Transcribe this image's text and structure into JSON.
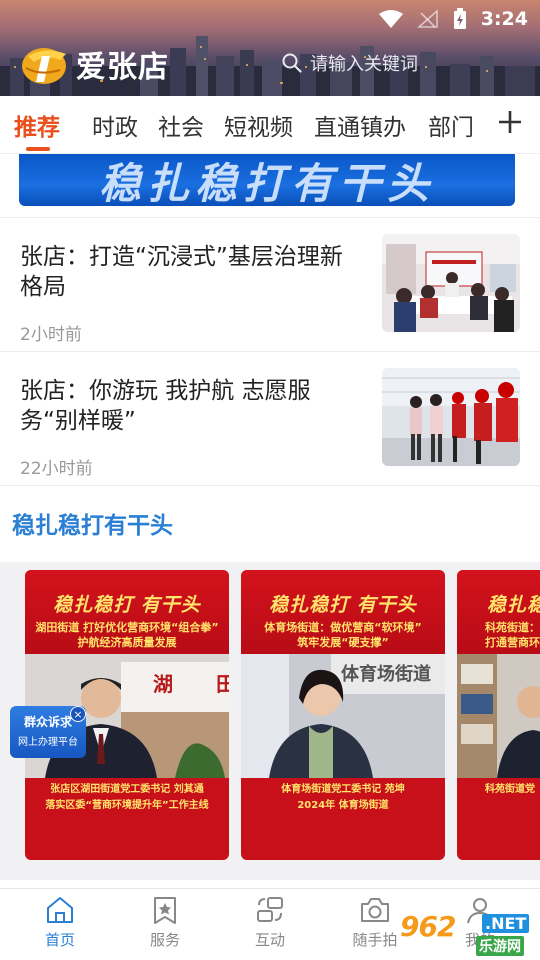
{
  "status_bar": {
    "time": "3:24"
  },
  "header": {
    "app_name": "爱张店",
    "search_placeholder": "请输入关键词"
  },
  "tabs": [
    {
      "label": "推荐",
      "active": true
    },
    {
      "label": "时政"
    },
    {
      "label": "社会"
    },
    {
      "label": "短视频"
    },
    {
      "label": "直通镇办"
    },
    {
      "label": "部门"
    }
  ],
  "banner": {
    "text": "稳扎稳打有干头"
  },
  "news": [
    {
      "title": "张店：打造“沉浸式”基层治理新格局",
      "time": "2小时前"
    },
    {
      "title": "张店：你游玩  我护航  志愿服务“别样暖”",
      "time": "22小时前"
    }
  ],
  "section": {
    "title": "稳扎稳打有干头"
  },
  "cards": [
    {
      "brand": "稳扎稳打 有干头",
      "sub1": "湖田街道 打好优化营商环境“组合拳”",
      "sub2": "护航经济高质量发展",
      "sign": "湖 田",
      "caption1": "张店区湖田街道党工委书记 刘其通",
      "caption2": "落实区委“营商环境提升年”工作主线"
    },
    {
      "brand": "稳扎稳打 有干头",
      "sub1": "体育场街道：做优营商“软环境”",
      "sub2": "筑牢发展“硬支撑”",
      "sign": "体育场街道",
      "caption1": "体育场街道党工委书记 苑坤",
      "caption2": "2024年 体育场街道"
    },
    {
      "brand": "稳扎稳打 有干头",
      "sub1": "科苑街道：",
      "sub2": "打通营商环",
      "sign": "",
      "caption1": "科苑街道党",
      "caption2": ""
    }
  ],
  "float_badge": {
    "line1": "群众诉求",
    "line2": "网上办理平台"
  },
  "bottom_nav": [
    {
      "label": "首页",
      "icon": "home-icon",
      "active": true
    },
    {
      "label": "服务",
      "icon": "star-bookmark-icon"
    },
    {
      "label": "互动",
      "icon": "interact-icon"
    },
    {
      "label": "随手拍",
      "icon": "camera-icon"
    },
    {
      "label": "我的",
      "icon": "user-icon"
    }
  ],
  "watermark": {
    "main": "962",
    "net": ".NET",
    "sub": "乐游网"
  },
  "colors": {
    "accent_orange": "#e8501e",
    "accent_blue": "#2a7fd4",
    "card_red": "#c8101a",
    "card_gold": "#ffe36a"
  }
}
